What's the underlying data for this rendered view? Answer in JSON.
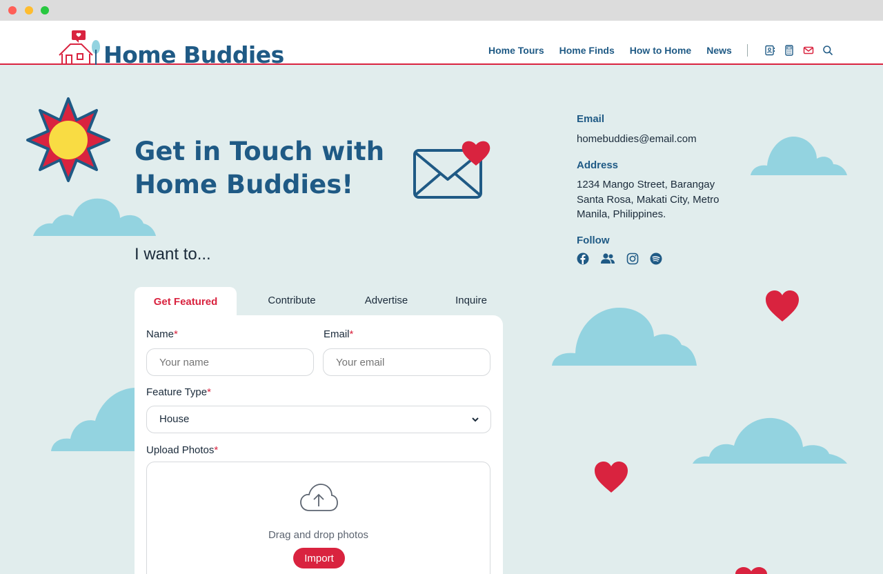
{
  "browser": {
    "window": "macOS browser window"
  },
  "header": {
    "logo_text": "Home Buddies",
    "nav": [
      {
        "label": "Home Tours"
      },
      {
        "label": "Home Finds"
      },
      {
        "label": "How to Home"
      },
      {
        "label": "News"
      }
    ],
    "utility_icons": [
      "contact-book-icon",
      "calculator-icon",
      "mail-icon",
      "search-icon"
    ]
  },
  "hero": {
    "title": "Get in Touch with Home Buddies!",
    "want": "I want to..."
  },
  "tabs": [
    {
      "label": "Get Featured",
      "active": true
    },
    {
      "label": "Contribute"
    },
    {
      "label": "Advertise"
    },
    {
      "label": "Inquire"
    }
  ],
  "form": {
    "name_label": "Name",
    "name_placeholder": "Your name",
    "email_label": "Email",
    "email_placeholder": "Your email",
    "feature_label": "Feature Type",
    "feature_value": "House",
    "upload_label": "Upload Photos",
    "upload_text": "Drag and drop photos",
    "import_label": "Import",
    "required_mark": "*"
  },
  "contact": {
    "email_heading": "Email",
    "email_value": "homebuddies@email.com",
    "address_heading": "Address",
    "address_value": "1234 Mango Street, Barangay Santa Rosa, Makati City, Metro Manila, Philippines.",
    "follow_heading": "Follow",
    "social_icons": [
      "facebook-icon",
      "group-icon",
      "instagram-icon",
      "spotify-icon"
    ]
  },
  "colors": {
    "brand_blue": "#1f5a85",
    "accent_red": "#d9233f",
    "background": "#e1eded",
    "cloud": "#93d3e0",
    "sun_yellow": "#f9dc43"
  }
}
